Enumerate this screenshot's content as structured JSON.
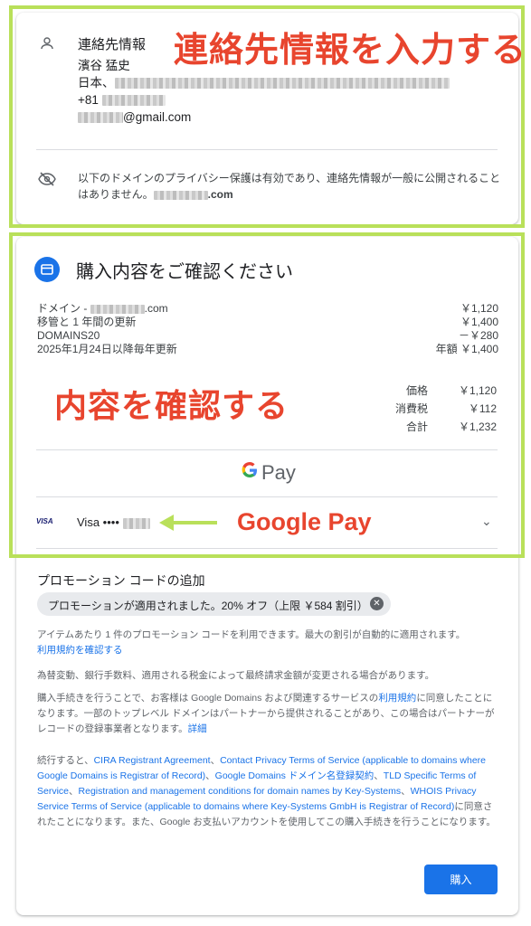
{
  "contact": {
    "title": "連絡先情報",
    "name": "濱谷 猛史",
    "address_prefix": "日本、",
    "phone_prefix": "+81",
    "email_suffix": "@gmail.com",
    "privacy_text": "以下のドメインのプライバシー保護は有効であり、連絡先情報が一般に公開されることはありません。",
    "privacy_domain_suffix": ".com"
  },
  "order": {
    "title": "購入内容をご確認ください",
    "items": [
      {
        "label_prefix": "ドメイン - ",
        "label_suffix": ".com",
        "value": "￥1,120"
      },
      {
        "label": "移管と 1 年間の更新",
        "value": "￥1,400"
      },
      {
        "label": "DOMAINS20",
        "value": "－￥280"
      },
      {
        "label": "2025年1月24日以降毎年更新",
        "value": "年額 ￥1,400"
      }
    ],
    "totals": [
      {
        "label": "価格",
        "value": "￥1,120"
      },
      {
        "label": "消費税",
        "value": "￥112"
      },
      {
        "label": "合計",
        "value": "￥1,232"
      }
    ],
    "gpay_label": "Pay",
    "card_brand": "VISA",
    "card_label": "Visa ••••"
  },
  "annotations": {
    "contact": "連絡先情報を入力する",
    "order": "内容を確認する",
    "gpay": "Google Pay"
  },
  "promo": {
    "title": "プロモーション コードの追加",
    "chip": "プロモーションが適用されました。20% オフ（上限 ￥584 割引）",
    "note": "アイテムあたり 1 件のプロモーション コードを利用できます。最大の割引が自動的に適用されます。",
    "terms_link": "利用規約を確認する"
  },
  "legal": {
    "currency_note": "為替変動、銀行手数料、適用される税金によって最終請求金額が変更される場合があります。",
    "agree_prefix": "購入手続きを行うことで、お客様は Google Domains および関連するサービスの",
    "agree_link": "利用規約",
    "agree_suffix": "に同意したことになります。一部のトップレベル ドメインはパートナーから提供されることがあり、この場合はパートナーがレコードの登録事業者となります。",
    "details_link": "詳細",
    "continue_prefix": "続行すると、",
    "links": [
      "CIRA Registrant Agreement",
      "Contact Privacy Terms of Service (applicable to domains where Google Domains is Registrar of Record)",
      "Google Domains ドメイン名登録契約",
      "TLD Specific Terms of Service",
      "Registration and management conditions for domain names by Key-Systems",
      "WHOIS Privacy Service Terms of Service (applicable to domains where Key-Systems GmbH is Registrar of Record)"
    ],
    "continue_suffix": "に同意されたことになります。また、Google お支払いアカウントを使用してこの購入手続きを行うことになります。"
  },
  "buy_button": "購入",
  "colors": {
    "accent": "#1a73e8",
    "highlight": "#b9e05a",
    "annotation": "#e8452e"
  }
}
